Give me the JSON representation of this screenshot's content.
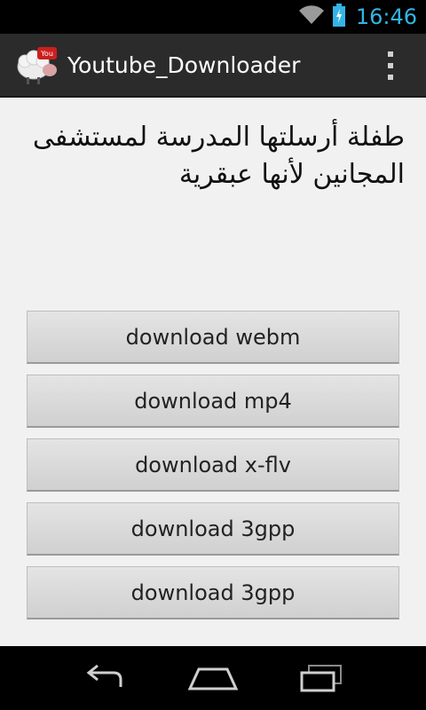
{
  "status_bar": {
    "time": "16:46",
    "wifi_icon": "wifi-icon",
    "battery_icon": "battery-charging-icon",
    "clock_color": "#33b5e5"
  },
  "action_bar": {
    "app_icon": "youtube-sheep-icon",
    "title": "Youtube_Downloader",
    "overflow_icon": "overflow-menu-icon"
  },
  "video": {
    "title": "طفلة أرسلتها المدرسة لمستشفى المجانين لأنها عبقرية"
  },
  "download_buttons": [
    {
      "label": "download webm"
    },
    {
      "label": "download mp4"
    },
    {
      "label": "download x-flv"
    },
    {
      "label": "download 3gpp"
    },
    {
      "label": "download 3gpp"
    }
  ],
  "nav_bar": {
    "back_icon": "back-icon",
    "home_icon": "home-icon",
    "recent_icon": "recent-apps-icon"
  }
}
